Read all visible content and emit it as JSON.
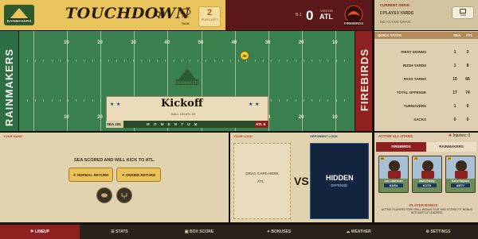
{
  "scoreboard": {
    "home_logo": "rainmakers-logo",
    "title": "TOUCHDOWN",
    "quarter": "Q3",
    "weather_icon": "rain-cloud-icon",
    "weather_label": "RAIN",
    "plays_left": "2",
    "plays_left_label": "PLAYS LEFT",
    "visitor_record": "B-1",
    "visitor_score": "0",
    "visitor_label": "VISITOR",
    "visitor_abbr": "ATL",
    "visitor_logo": "firebirds-logo"
  },
  "current_drive": {
    "title": "CURRENT DRIVE",
    "plays": "0 PLAYS",
    "yards": "0 YARDS",
    "status": "NO ACTIVE DRIVE",
    "total_label": "Total"
  },
  "field": {
    "home_endzone": "RAINMAKERS",
    "away_endzone": "FIREBIRDS",
    "yard_numbers_top": [
      "10",
      "20",
      "30",
      "40",
      "50",
      "40",
      "30",
      "20",
      "10"
    ],
    "yard_numbers_bottom": [
      "10",
      "20",
      "30",
      "40",
      "50",
      "40",
      "30",
      "20",
      "10"
    ],
    "ball_marker": "30"
  },
  "kickoff": {
    "title": "Kickoff",
    "subtitle": "BALL ON ATL 33",
    "momentum_left": "SEA 181",
    "momentum_text": "MOMENTUM",
    "momentum_right": "ATL 8"
  },
  "quick_stats": {
    "title": "QUICK STATS",
    "col_home": "SEA",
    "col_away": "ATL",
    "rows": [
      {
        "name": "FIRST DOWNS",
        "home": "1",
        "away": "3"
      },
      {
        "name": "RUSH YARDS",
        "home": "1",
        "away": "8"
      },
      {
        "name": "PASS YARDS",
        "home": "15",
        "away": "66"
      },
      {
        "name": "TOTAL OFFENSE",
        "home": "17",
        "away": "74"
      },
      {
        "name": "TURNOVERS",
        "home": "1",
        "away": "0"
      },
      {
        "name": "SACKS",
        "home": "0",
        "away": "0"
      }
    ]
  },
  "hand": {
    "title": "YOUR HAND",
    "message": "SEA SCORED AND WILL KICK TO ATL.",
    "normal_return": "NORMAL RETURN",
    "onside_return": "ONSIDE RETURN",
    "pass": "PASS",
    "field": "FIELD"
  },
  "lock": {
    "title": "YOUR LOCK",
    "drop_text": "DRAG CARD HERE",
    "drop_team": "ATL",
    "vs": "VS",
    "opponent_title": "OPPONENT LOCK",
    "hidden": "HIDDEN",
    "hidden_sub": "OFFENSE"
  },
  "allstars": {
    "title": "ACTIVE ALL-STARS",
    "injuries": "Injuries: 0",
    "tab_active": "FIREBIRDS",
    "tab_other": "RAINMAKERS",
    "players": [
      {
        "name": "Joe Lawrence",
        "rating": "61/84",
        "number": "86"
      },
      {
        "name": "Mark Farley",
        "rating": "67/70",
        "number": "28"
      },
      {
        "name": "Kane Haynes",
        "rating": "68/77",
        "number": "20"
      }
    ],
    "bonus_title": "PLAYER BONUS",
    "bonus_text": "ACTIVE PLAYERS FEED SKILL BONUS STAT AND SCORE-FIT BONUS INTO BATTLE LEADERS."
  },
  "nav": [
    {
      "label": "LINEUP",
      "icon": "lineup-icon",
      "active": true
    },
    {
      "label": "STATS",
      "icon": "stats-icon",
      "active": false
    },
    {
      "label": "BOX SCORE",
      "icon": "box-score-icon",
      "active": false
    },
    {
      "label": "BONUSES",
      "icon": "bonuses-icon",
      "active": false
    },
    {
      "label": "WEATHER",
      "icon": "weather-icon",
      "active": false
    },
    {
      "label": "SETTINGS",
      "icon": "settings-icon",
      "active": false
    }
  ],
  "colors": {
    "gold": "#e9c45c",
    "crimson": "#8e2020",
    "field_green": "#3a7f4e",
    "navy": "#12243e"
  }
}
